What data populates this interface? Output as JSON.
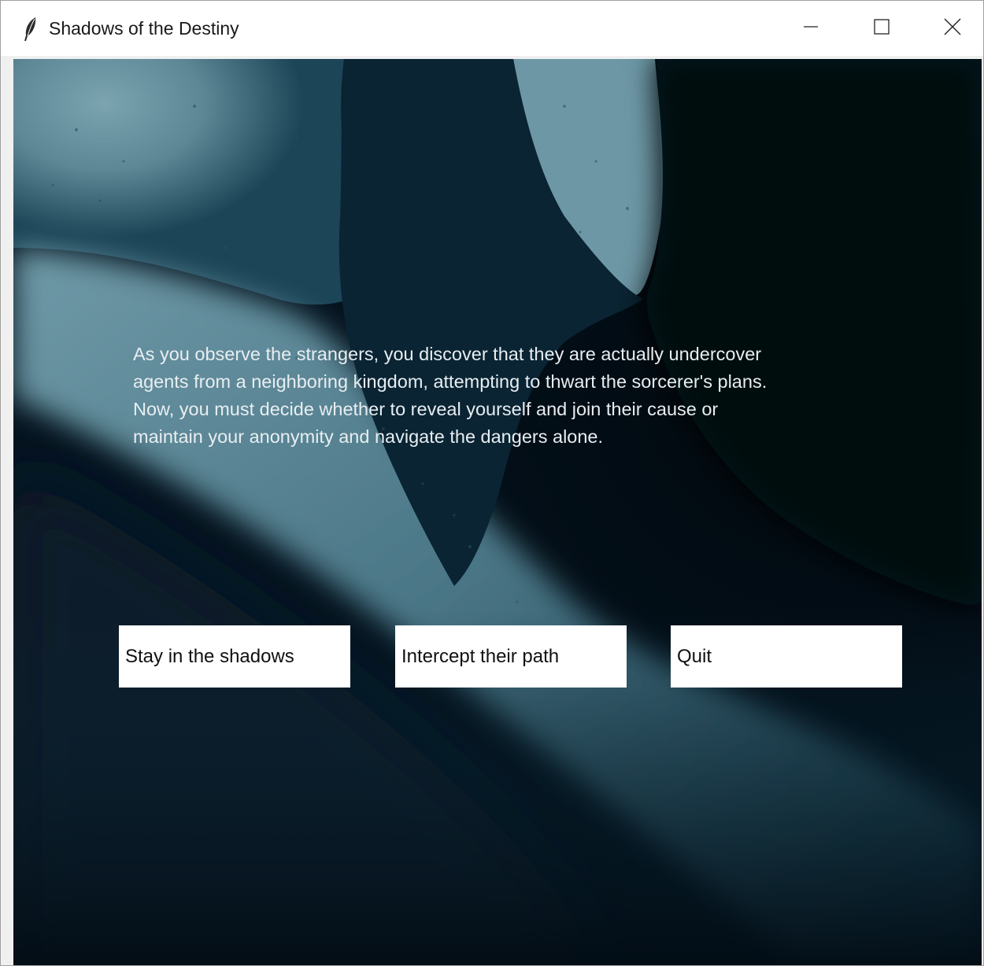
{
  "window": {
    "title": "Shadows of the Destiny",
    "app_icon": "feather-icon",
    "controls": {
      "minimize_icon": "minimize-icon",
      "maximize_icon": "maximize-icon",
      "close_icon": "close-icon"
    }
  },
  "scene": {
    "background_colors": {
      "dark": "#03101a",
      "mid": "#0d3447",
      "light": "#6d98a6"
    },
    "story_text": "As you observe the strangers, you discover that they are actually undercover\nagents from a neighboring kingdom, attempting to thwart the sorcerer's plans.\nNow, you must decide whether to reveal yourself and join their cause or\nmaintain your anonymity and navigate the dangers alone."
  },
  "choices": [
    {
      "label": "Stay in the shadows"
    },
    {
      "label": "Intercept their path"
    },
    {
      "label": "Quit"
    }
  ]
}
